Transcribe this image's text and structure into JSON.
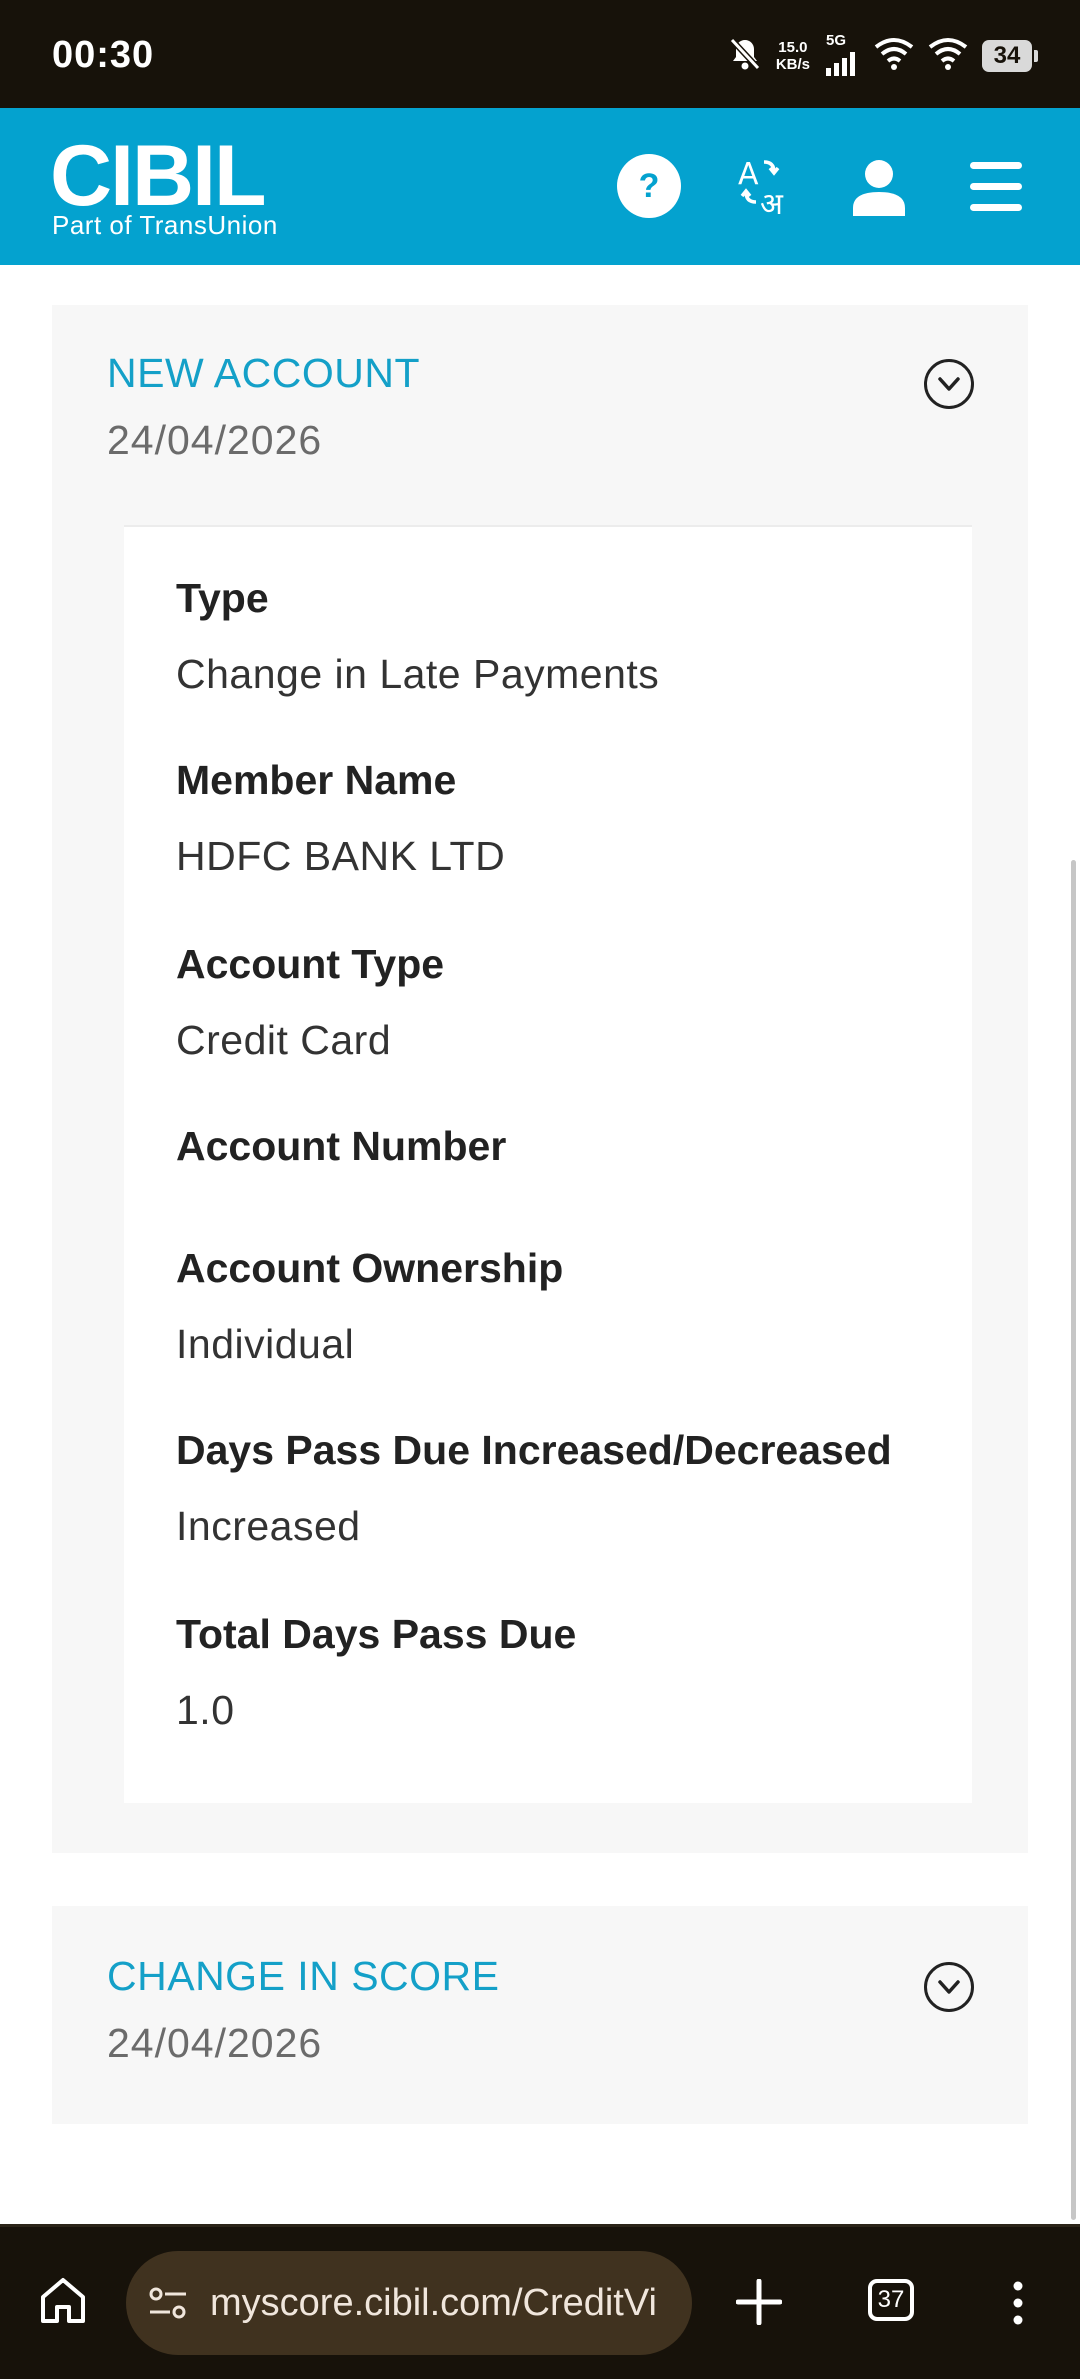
{
  "status_bar": {
    "time": "00:30",
    "net_speed_value": "15.0",
    "net_speed_unit": "KB/s",
    "network": "5G",
    "battery": "34",
    "icons": [
      "mute-bell-icon",
      "signal-icon",
      "wifi-plus-icon",
      "wifi-icon",
      "battery-icon"
    ]
  },
  "header": {
    "logo": "CIBIL",
    "logo_sub": "Part of TransUnion",
    "help_label": "?",
    "icons": [
      "help-icon",
      "translate-icon",
      "profile-icon",
      "menu-icon"
    ],
    "brand_color": "#04a2cf"
  },
  "new_account": {
    "title": "NEW ACCOUNT",
    "date": "24/04/2026",
    "fields": [
      {
        "label": "Type",
        "value": "Change in Late Payments"
      },
      {
        "label": "Member Name",
        "value": "HDFC BANK LTD"
      },
      {
        "label": "Account Type",
        "value": "Credit Card"
      },
      {
        "label": "Account Number",
        "value": ""
      },
      {
        "label": "Account Ownership",
        "value": "Individual"
      },
      {
        "label": "Days Pass Due Increased/Decreased",
        "value": "Increased"
      },
      {
        "label": "Total Days Pass Due",
        "value": "1.0"
      }
    ]
  },
  "change_in_score": {
    "title": "CHANGE IN SCORE",
    "date": "24/04/2026"
  },
  "browser": {
    "url": "myscore.cibil.com/CreditVi",
    "tab_count": "37",
    "icons": [
      "home-icon",
      "site-settings-icon",
      "new-tab-icon",
      "tabs-icon",
      "more-icon"
    ]
  }
}
